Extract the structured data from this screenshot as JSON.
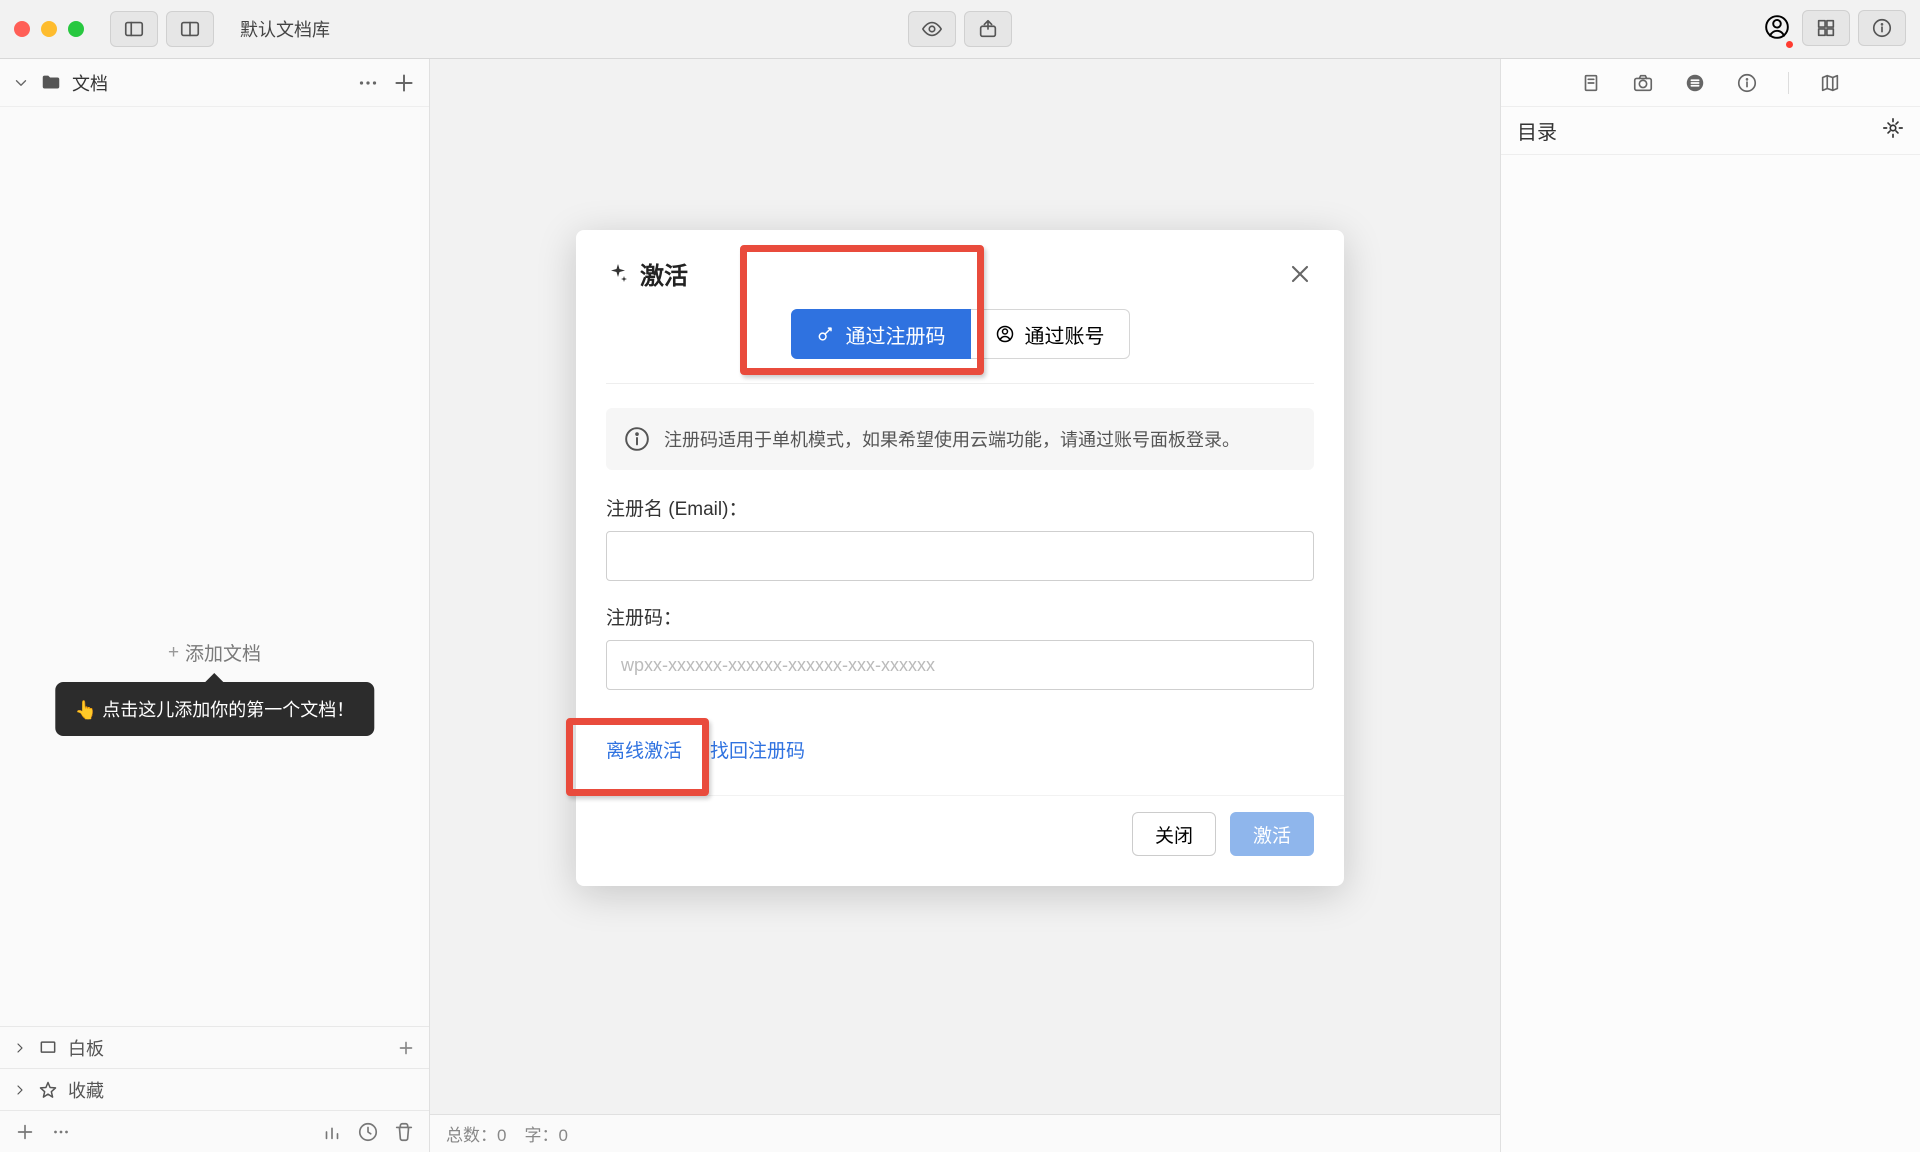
{
  "titlebar": {
    "library_name": "默认文档库"
  },
  "sidebar": {
    "docs_label": "文档",
    "add_doc_label": "添加文档",
    "tooltip": "👆 点击这儿添加你的第一个文档！",
    "sections": {
      "whiteboard": "白板",
      "favorites": "收藏"
    }
  },
  "rightpanel": {
    "title": "目录"
  },
  "statusbar": {
    "total_label": "总数：",
    "total_value": "0",
    "chars_label": "字：",
    "chars_value": "0"
  },
  "modal": {
    "title": "激活",
    "tab_code": "通过注册码",
    "tab_account": "通过账号",
    "notice": "注册码适用于单机模式，如果希望使用云端功能，请通过账号面板登录。",
    "email_label": "注册名 (Email)：",
    "code_label": "注册码：",
    "code_placeholder": "wpxx-xxxxxx-xxxxxx-xxxxxx-xxx-xxxxxx",
    "offline_link": "离线激活",
    "findcode_link": "找回注册码",
    "close_btn": "关闭",
    "activate_btn": "激活"
  }
}
